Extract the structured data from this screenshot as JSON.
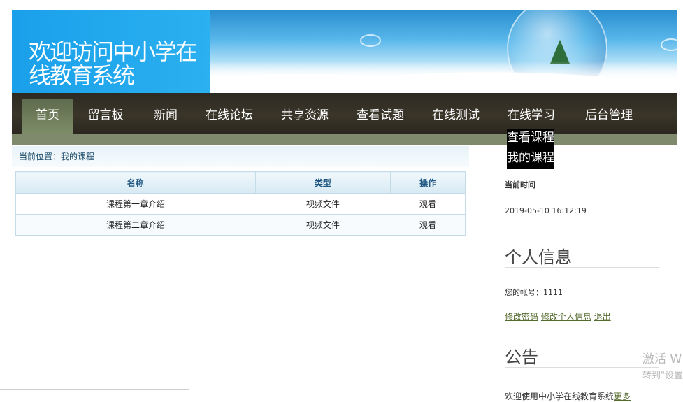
{
  "banner": {
    "title": "欢迎访问中小学在线教育系统"
  },
  "nav": {
    "items": [
      "首页",
      "留言板",
      "新闻",
      "在线论坛",
      "共享资源",
      "查看试题",
      "在线测试",
      "在线学习",
      "后台管理"
    ],
    "active": "首页",
    "dropdown": [
      "查看课程",
      "我的课程"
    ]
  },
  "breadcrumb": "当前位置：我的课程",
  "table": {
    "headers": [
      "名称",
      "类型",
      "操作"
    ],
    "rows": [
      [
        "课程第一章介绍",
        "视频文件",
        "观看"
      ],
      [
        "课程第二章介绍",
        "视频文件",
        "观看"
      ]
    ]
  },
  "sidebar": {
    "time_label": "当前时间",
    "time_value": "2019-05-10 16:12:19",
    "profile_heading": "个人信息",
    "account_text": "您的帐号：1111",
    "links": [
      "修改密码",
      "修改个人信息",
      "退出"
    ],
    "notice_heading": "公告",
    "notice_text": "欢迎使用中小学在线教育系统",
    "notice_more": "更多"
  },
  "watermark": {
    "line1": "激活 W",
    "line2": "转到\"设置"
  },
  "colors": {
    "nav_bg": "#2d2a22",
    "nav_active": "#7e8d68",
    "banner_blue": "#1aa0ea",
    "link": "#556b2f"
  }
}
